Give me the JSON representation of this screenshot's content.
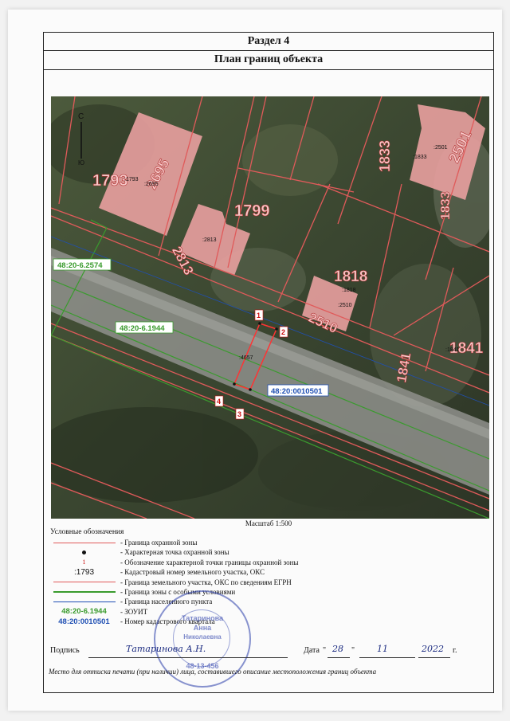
{
  "section_title": "Раздел 4",
  "plan_title": "План границ объекта",
  "north_letters": {
    "top": "С",
    "bottom": "Ю"
  },
  "map_labels": {
    "big_parcels": [
      "1793",
      "2695",
      "1799",
      "2813",
      "1833",
      "2501",
      "1833",
      "1818",
      "2510",
      "1841",
      "1841"
    ],
    "small_cad": [
      ":1793",
      ":2695",
      ":2813",
      ":1833",
      ":2501",
      ":1818",
      ":2510",
      ":1841",
      ":4657"
    ],
    "zouit_1": "48:20-6.2574",
    "zouit_2": "48:20-6.1944",
    "quarter": "48:20:0010501",
    "points": [
      "1",
      "2",
      "3",
      "4"
    ]
  },
  "scale": "Масштаб 1:500",
  "legend": {
    "title": "Условные обозначения",
    "items": [
      {
        "symbol": "",
        "text": "- Граница охранной зоны"
      },
      {
        "symbol": "",
        "text": "- Характерная точка охранной зоны"
      },
      {
        "symbol": "1",
        "text": "- Обозначение характерной точки границы охранной зоны"
      },
      {
        "symbol": ":1793",
        "text": "- Кадастровый номер земельного участка, ОКС"
      },
      {
        "symbol": "",
        "text": "- Граница земельного участка, ОКС по сведениям ЕГРН"
      },
      {
        "symbol": "",
        "text": "- Граница зоны с особыми условиями"
      },
      {
        "symbol": "",
        "text": "- Граница населенного пункта"
      },
      {
        "symbol": "48:20-6.1944",
        "text": "- ЗОУИТ"
      },
      {
        "symbol": "48:20:0010501",
        "text": "- Номер кадастрового квартала"
      }
    ]
  },
  "signature": {
    "label": "Подпись",
    "handwritten": "Татаринова А.Н.",
    "date_label": "Дата",
    "day": "28",
    "month": "11",
    "year": "2022",
    "year_suffix": "г."
  },
  "stamp_lines": [
    "Татаринова",
    "Анна",
    "Николаевна",
    "48-13-456"
  ],
  "footer_note": "Место для оттиска печати (при наличии) лица, составившего описание местоположения границ объекта",
  "colors": {
    "parcel": "#e05a5a",
    "zouit": "#3a9b2e",
    "quarter": "#1f4fb3",
    "building": "#e9a0a0"
  }
}
